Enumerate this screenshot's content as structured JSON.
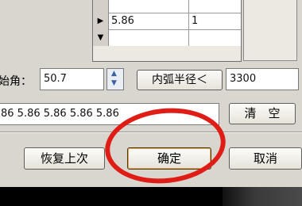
{
  "grid": {
    "rows": [
      {
        "marker": "▶",
        "col1": "5.86",
        "col2": "1"
      },
      {
        "marker": "▼",
        "col1": "",
        "col2": ""
      }
    ]
  },
  "start_angle": {
    "label": "始角：",
    "value": "50.7"
  },
  "inner_radius": {
    "button_label": "内弧半径＜",
    "value": "3300"
  },
  "values_field": {
    "value": "86 5.86 5.86 5.86 5.86"
  },
  "clear_button": {
    "label": "清　空"
  },
  "restore_button": {
    "label": "恢复上次"
  },
  "ok_button": {
    "label": "确定"
  },
  "cancel_button": {
    "label": "取消"
  },
  "colors": {
    "annotation_ring": "#e01c16",
    "dialog_bg": "#d8d6ce"
  }
}
